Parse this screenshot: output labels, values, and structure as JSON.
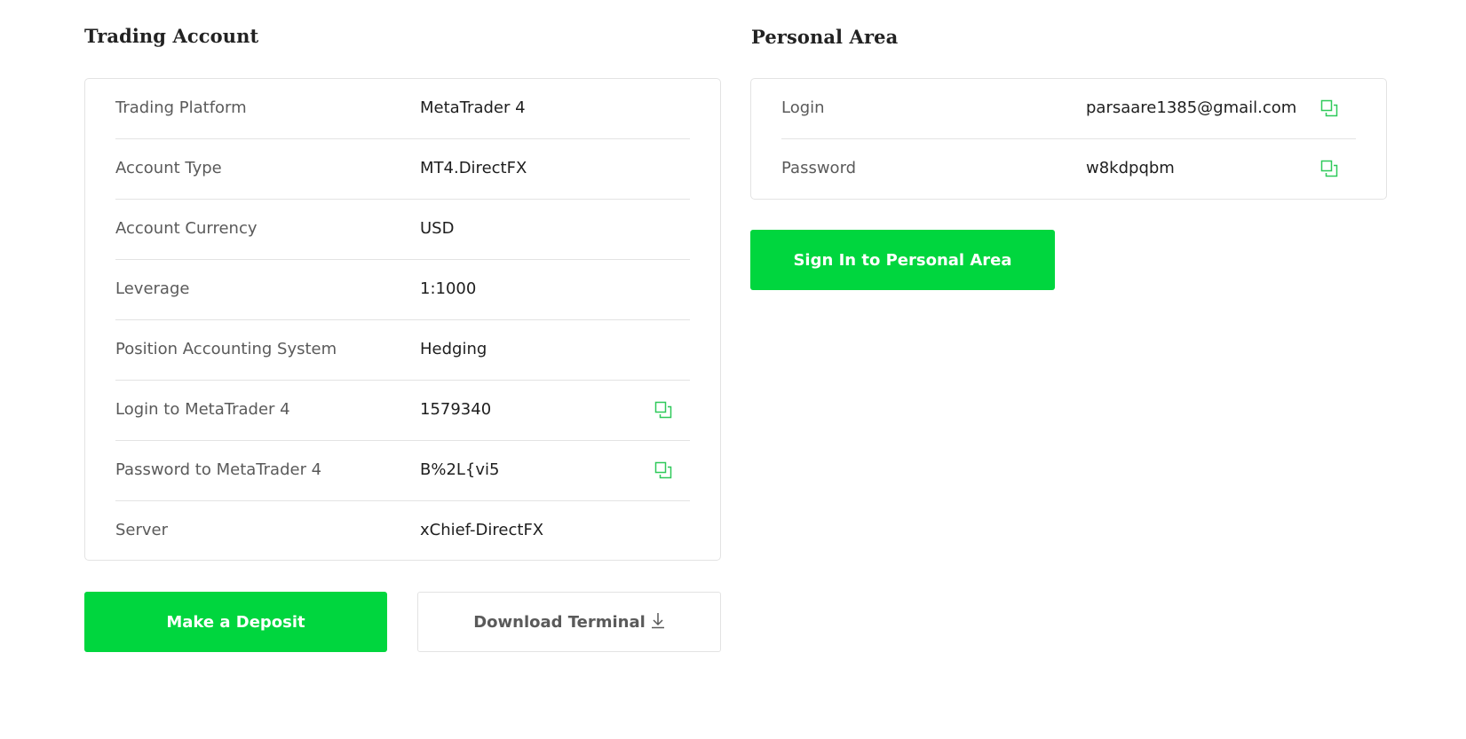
{
  "trading_account": {
    "title": "Trading Account",
    "rows": [
      {
        "label": "Trading Platform",
        "value": "MetaTrader 4",
        "copyable": false
      },
      {
        "label": "Account Type",
        "value": "MT4.DirectFX",
        "copyable": false
      },
      {
        "label": "Account Currency",
        "value": "USD",
        "copyable": false
      },
      {
        "label": "Leverage",
        "value": "1:1000",
        "copyable": false
      },
      {
        "label": "Position Accounting System",
        "value": "Hedging",
        "copyable": false
      },
      {
        "label": "Login to MetaTrader 4",
        "value": "1579340",
        "copyable": true
      },
      {
        "label": "Password to MetaTrader 4",
        "value": "B%2L{vi5",
        "copyable": true
      },
      {
        "label": "Server",
        "value": "xChief-DirectFX",
        "copyable": false
      }
    ],
    "deposit_button": "Make a Deposit",
    "download_button": "Download Terminal",
    "download_icon": "download-arrow-icon"
  },
  "personal_area": {
    "title": "Personal Area",
    "rows": [
      {
        "label": "Login",
        "value": "parsaare1385@gmail.com",
        "copyable": true
      },
      {
        "label": "Password",
        "value": "w8kdpqbm",
        "copyable": true
      }
    ],
    "sign_in_button": "Sign In to Personal Area"
  },
  "icons": {
    "copy": "copy-icon"
  },
  "colors": {
    "accent": "#00d63e",
    "copy_icon": "#2fc95a",
    "border": "#e3e3e3",
    "label_text": "#5a5a5a",
    "value_text": "#1e1e1e"
  }
}
